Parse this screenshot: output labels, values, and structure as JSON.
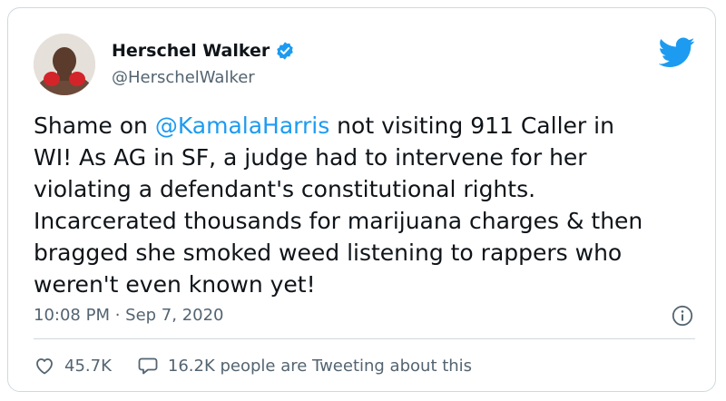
{
  "author": {
    "name": "Herschel Walker",
    "handle": "@HerschelWalker",
    "verified": true
  },
  "tweet": {
    "text_before": "Shame on ",
    "mention": "@KamalaHarris",
    "text_after": " not visiting 911 Caller in\nWI! As AG in SF, a judge had to intervene for her\nviolating a defendant's constitutional rights.\nIncarcerated thousands for marijuana charges & then\nbragged she smoked weed listening to rappers who\nweren't even known yet!"
  },
  "meta": {
    "timestamp": "10:08 PM · Sep 7, 2020"
  },
  "stats": {
    "likes": "45.7K",
    "conversation": "16.2K people are Tweeting about this"
  },
  "colors": {
    "accent": "#1d9bf0",
    "text": "#0f1419",
    "secondary": "#536471",
    "border": "#cfd9de"
  },
  "icons": {
    "brand": "twitter-bird-icon",
    "verified": "verified-badge-icon",
    "info": "info-icon",
    "like": "heart-icon",
    "reply": "speech-bubble-icon"
  }
}
